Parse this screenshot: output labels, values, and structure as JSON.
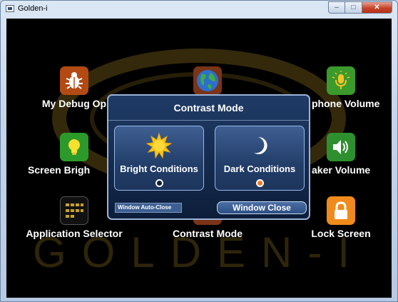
{
  "window": {
    "title": "Golden-i",
    "controls": {
      "minimize": "–",
      "maximize": "□",
      "close": "✕"
    }
  },
  "background_brand": "GOLDEN-I",
  "tiles": [
    {
      "label": "My Debug Op",
      "icon": "bug-icon"
    },
    {
      "label": "",
      "icon": "globe-icon"
    },
    {
      "label": "phone Volume",
      "icon": "microphone-icon"
    },
    {
      "label": "Screen Brigh",
      "icon": "lightbulb-icon"
    },
    {
      "label": "aker Volume",
      "icon": "speaker-icon"
    },
    {
      "label": "Application Selector",
      "icon": "app-grid-icon"
    },
    {
      "label": "Contrast Mode",
      "icon": "contrast-icon"
    },
    {
      "label": "Lock Screen",
      "icon": "lock-icon"
    }
  ],
  "dialog": {
    "title": "Contrast Mode",
    "options": [
      {
        "label": "Bright Conditions",
        "icon": "sun-icon",
        "selected": false
      },
      {
        "label": "Dark Conditions",
        "icon": "moon-icon",
        "selected": true
      }
    ],
    "auto_close_label": "Window Auto-Close",
    "window_close_label": "Window Close"
  },
  "colors": {
    "dialog_bg": "#0d1e3a",
    "accent_orange": "#f07a1e",
    "brand_gold": "#c9a227"
  }
}
